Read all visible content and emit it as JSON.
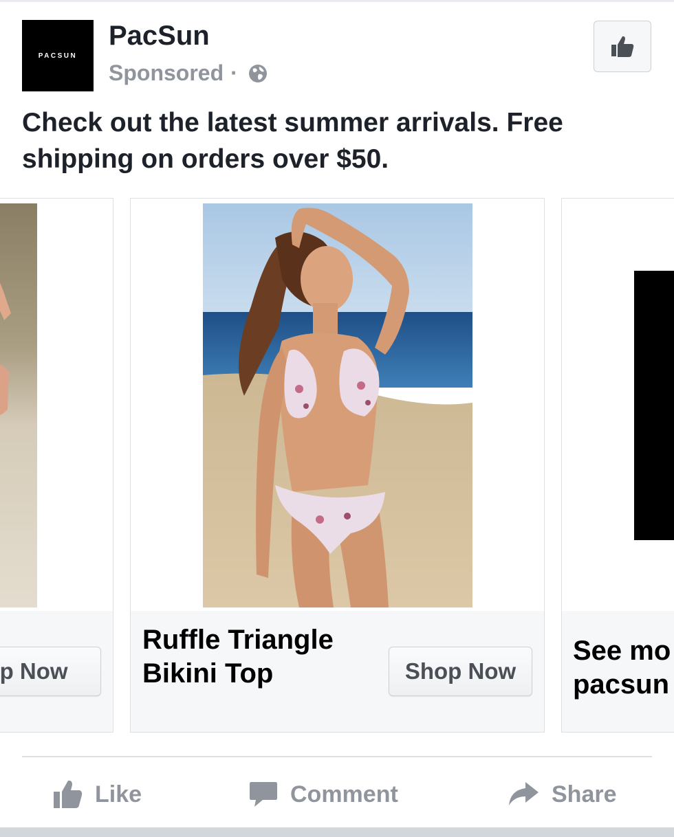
{
  "post": {
    "page_name": "PacSun",
    "avatar_text": "PACSUN",
    "sponsored_label": "Sponsored",
    "meta_separator": "·",
    "privacy_icon": "globe-icon",
    "like_page_icon": "thumbs-up-icon",
    "message": "Check out the latest summer arrivals. Free shipping on orders over $50."
  },
  "carousel": {
    "cards": [
      {
        "title": "",
        "cta": "op Now"
      },
      {
        "title": "Ruffle Triangle Bikini Top",
        "cta": "Shop Now"
      },
      {
        "title_line1": "See mo",
        "title_line2": "pacsun"
      }
    ]
  },
  "actions": {
    "like": "Like",
    "comment": "Comment",
    "share": "Share"
  },
  "colors": {
    "text": "#1d2129",
    "muted": "#90949c",
    "border": "#dddfe2",
    "button_bg": "#f6f7f9"
  }
}
